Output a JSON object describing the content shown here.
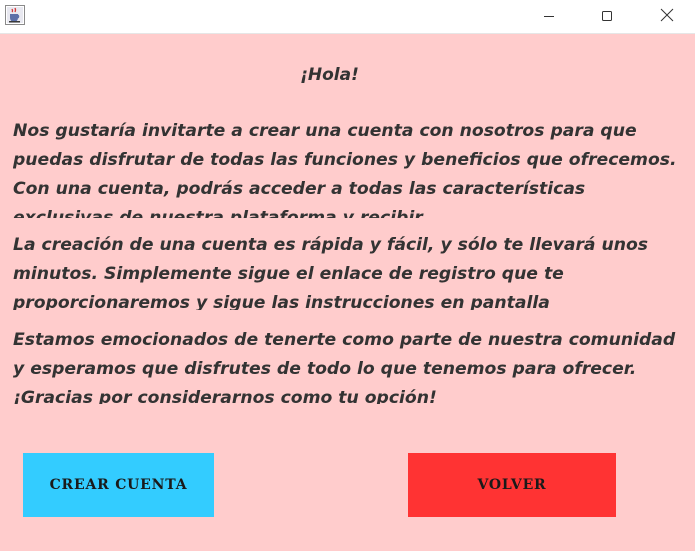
{
  "window": {
    "icon": "java-coffee-cup-icon",
    "controls": [
      "minimize-icon",
      "maximize-icon",
      "close-icon"
    ]
  },
  "greeting": "¡Hola!",
  "paragraphs": [
    "Nos gustaría invitarte a crear una cuenta con nosotros para que puedas disfrutar de todas las funciones y beneficios que ofrecemos. Con una cuenta, podrás acceder a todas las características exclusivas de nuestra plataforma y recibir",
    "La creación de una cuenta es rápida y fácil, y sólo te llevará unos minutos. Simplemente sigue el enlace de registro que te proporcionaremos y sigue las instrucciones en pantalla",
    "Estamos emocionados de tenerte como parte de nuestra comunidad y esperamos que disfrutes de todo lo que tenemos para ofrecer. ¡Gracias por considerarnos como tu opción!"
  ],
  "buttons": {
    "create_account": "CREAR CUENTA",
    "back": "VOLVER"
  },
  "colors": {
    "background": "#ffcccc",
    "create_button": "#33ccff",
    "back_button": "#ff3333",
    "text": "#333333"
  }
}
